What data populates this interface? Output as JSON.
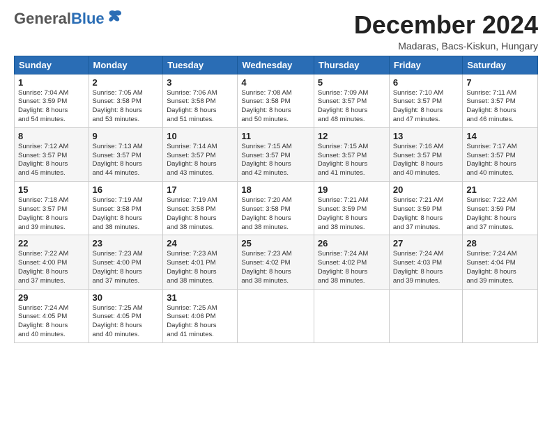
{
  "logo": {
    "general": "General",
    "blue": "Blue"
  },
  "title": "December 2024",
  "location": "Madaras, Bacs-Kiskun, Hungary",
  "headers": [
    "Sunday",
    "Monday",
    "Tuesday",
    "Wednesday",
    "Thursday",
    "Friday",
    "Saturday"
  ],
  "weeks": [
    [
      {
        "day": "1",
        "info": "Sunrise: 7:04 AM\nSunset: 3:59 PM\nDaylight: 8 hours\nand 54 minutes."
      },
      {
        "day": "2",
        "info": "Sunrise: 7:05 AM\nSunset: 3:58 PM\nDaylight: 8 hours\nand 53 minutes."
      },
      {
        "day": "3",
        "info": "Sunrise: 7:06 AM\nSunset: 3:58 PM\nDaylight: 8 hours\nand 51 minutes."
      },
      {
        "day": "4",
        "info": "Sunrise: 7:08 AM\nSunset: 3:58 PM\nDaylight: 8 hours\nand 50 minutes."
      },
      {
        "day": "5",
        "info": "Sunrise: 7:09 AM\nSunset: 3:57 PM\nDaylight: 8 hours\nand 48 minutes."
      },
      {
        "day": "6",
        "info": "Sunrise: 7:10 AM\nSunset: 3:57 PM\nDaylight: 8 hours\nand 47 minutes."
      },
      {
        "day": "7",
        "info": "Sunrise: 7:11 AM\nSunset: 3:57 PM\nDaylight: 8 hours\nand 46 minutes."
      }
    ],
    [
      {
        "day": "8",
        "info": "Sunrise: 7:12 AM\nSunset: 3:57 PM\nDaylight: 8 hours\nand 45 minutes."
      },
      {
        "day": "9",
        "info": "Sunrise: 7:13 AM\nSunset: 3:57 PM\nDaylight: 8 hours\nand 44 minutes."
      },
      {
        "day": "10",
        "info": "Sunrise: 7:14 AM\nSunset: 3:57 PM\nDaylight: 8 hours\nand 43 minutes."
      },
      {
        "day": "11",
        "info": "Sunrise: 7:15 AM\nSunset: 3:57 PM\nDaylight: 8 hours\nand 42 minutes."
      },
      {
        "day": "12",
        "info": "Sunrise: 7:15 AM\nSunset: 3:57 PM\nDaylight: 8 hours\nand 41 minutes."
      },
      {
        "day": "13",
        "info": "Sunrise: 7:16 AM\nSunset: 3:57 PM\nDaylight: 8 hours\nand 40 minutes."
      },
      {
        "day": "14",
        "info": "Sunrise: 7:17 AM\nSunset: 3:57 PM\nDaylight: 8 hours\nand 40 minutes."
      }
    ],
    [
      {
        "day": "15",
        "info": "Sunrise: 7:18 AM\nSunset: 3:57 PM\nDaylight: 8 hours\nand 39 minutes."
      },
      {
        "day": "16",
        "info": "Sunrise: 7:19 AM\nSunset: 3:58 PM\nDaylight: 8 hours\nand 38 minutes."
      },
      {
        "day": "17",
        "info": "Sunrise: 7:19 AM\nSunset: 3:58 PM\nDaylight: 8 hours\nand 38 minutes."
      },
      {
        "day": "18",
        "info": "Sunrise: 7:20 AM\nSunset: 3:58 PM\nDaylight: 8 hours\nand 38 minutes."
      },
      {
        "day": "19",
        "info": "Sunrise: 7:21 AM\nSunset: 3:59 PM\nDaylight: 8 hours\nand 38 minutes."
      },
      {
        "day": "20",
        "info": "Sunrise: 7:21 AM\nSunset: 3:59 PM\nDaylight: 8 hours\nand 37 minutes."
      },
      {
        "day": "21",
        "info": "Sunrise: 7:22 AM\nSunset: 3:59 PM\nDaylight: 8 hours\nand 37 minutes."
      }
    ],
    [
      {
        "day": "22",
        "info": "Sunrise: 7:22 AM\nSunset: 4:00 PM\nDaylight: 8 hours\nand 37 minutes."
      },
      {
        "day": "23",
        "info": "Sunrise: 7:23 AM\nSunset: 4:00 PM\nDaylight: 8 hours\nand 37 minutes."
      },
      {
        "day": "24",
        "info": "Sunrise: 7:23 AM\nSunset: 4:01 PM\nDaylight: 8 hours\nand 38 minutes."
      },
      {
        "day": "25",
        "info": "Sunrise: 7:23 AM\nSunset: 4:02 PM\nDaylight: 8 hours\nand 38 minutes."
      },
      {
        "day": "26",
        "info": "Sunrise: 7:24 AM\nSunset: 4:02 PM\nDaylight: 8 hours\nand 38 minutes."
      },
      {
        "day": "27",
        "info": "Sunrise: 7:24 AM\nSunset: 4:03 PM\nDaylight: 8 hours\nand 39 minutes."
      },
      {
        "day": "28",
        "info": "Sunrise: 7:24 AM\nSunset: 4:04 PM\nDaylight: 8 hours\nand 39 minutes."
      }
    ],
    [
      {
        "day": "29",
        "info": "Sunrise: 7:24 AM\nSunset: 4:05 PM\nDaylight: 8 hours\nand 40 minutes."
      },
      {
        "day": "30",
        "info": "Sunrise: 7:25 AM\nSunset: 4:05 PM\nDaylight: 8 hours\nand 40 minutes."
      },
      {
        "day": "31",
        "info": "Sunrise: 7:25 AM\nSunset: 4:06 PM\nDaylight: 8 hours\nand 41 minutes."
      },
      null,
      null,
      null,
      null
    ]
  ]
}
